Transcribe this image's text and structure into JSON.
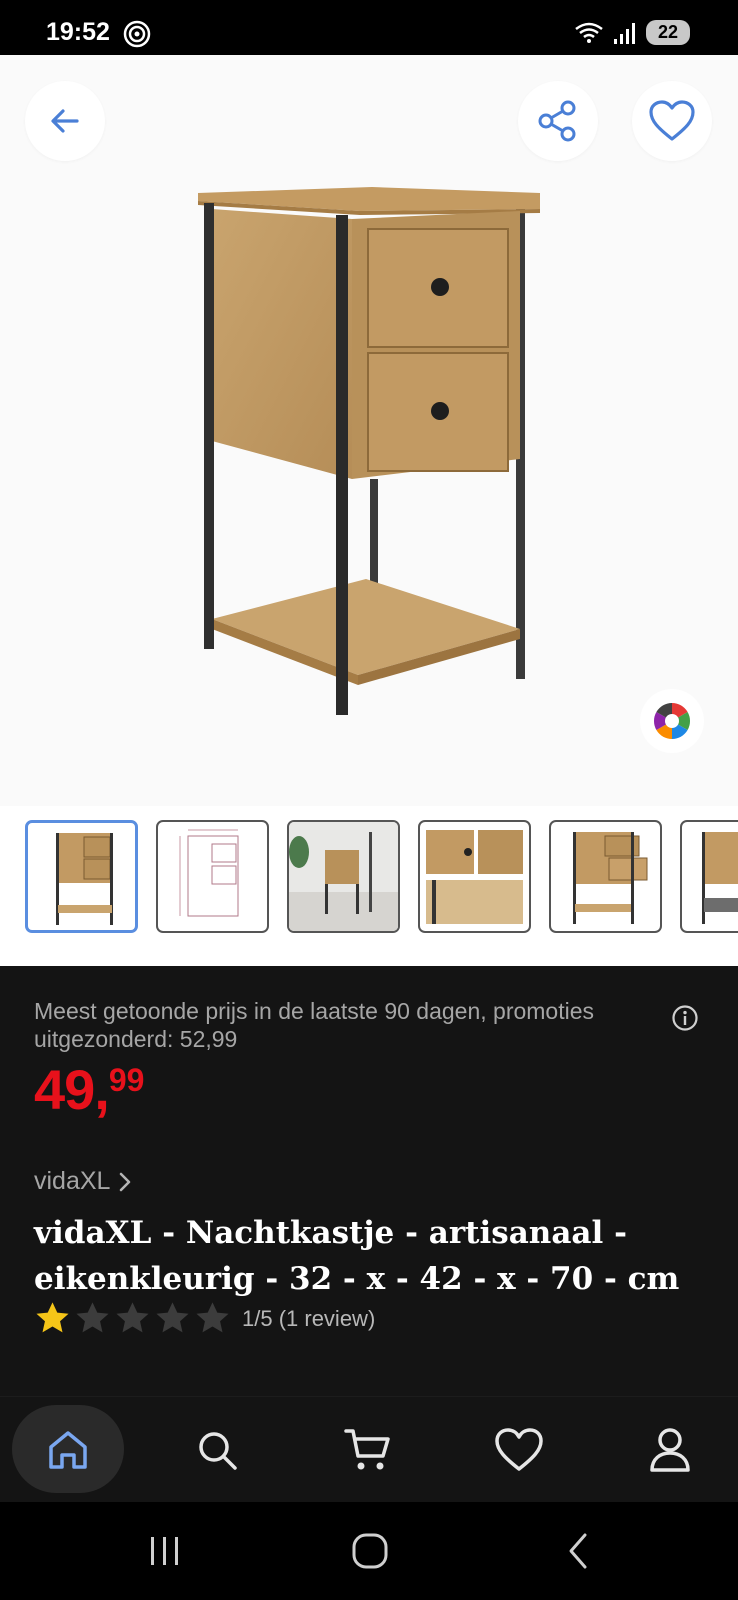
{
  "status_bar": {
    "time": "19:52",
    "battery": "22",
    "icons": [
      "at-ring-icon",
      "wifi-icon",
      "signal-icon",
      "battery-icon"
    ]
  },
  "hero": {
    "buttons": [
      "back-arrow-icon",
      "share-icon",
      "heart-icon"
    ],
    "color_picker_icon": "color-wheel-icon"
  },
  "thumbnails": {
    "selected_index": 0,
    "count_visible": 6,
    "accent": "#5a8ee0"
  },
  "product": {
    "price_note": "Meest getoonde prijs in de laatste 90 dagen, promoties uitgezonderd: 52,99",
    "price_main": "49",
    "price_cents": "99",
    "price_sep": ",",
    "price_color": "#e8111b",
    "brand": "vidaXL",
    "title": "vidaXL - Nachtkastje - artisanaal - eikenkleurig - 32 - x - 42 - x - 70 - cm",
    "rating_value": 1,
    "rating_max": 5,
    "rating_text": "1/5 (1 review)",
    "star_color": "#f5c518"
  },
  "bottom_nav": {
    "items": [
      "home-icon",
      "search-icon",
      "cart-icon",
      "heart-icon",
      "account-icon"
    ],
    "active": "home-icon",
    "active_color": "#7aa7f0"
  },
  "system_nav": [
    "recents-icon",
    "home-circle-icon",
    "back-chevron-icon"
  ]
}
